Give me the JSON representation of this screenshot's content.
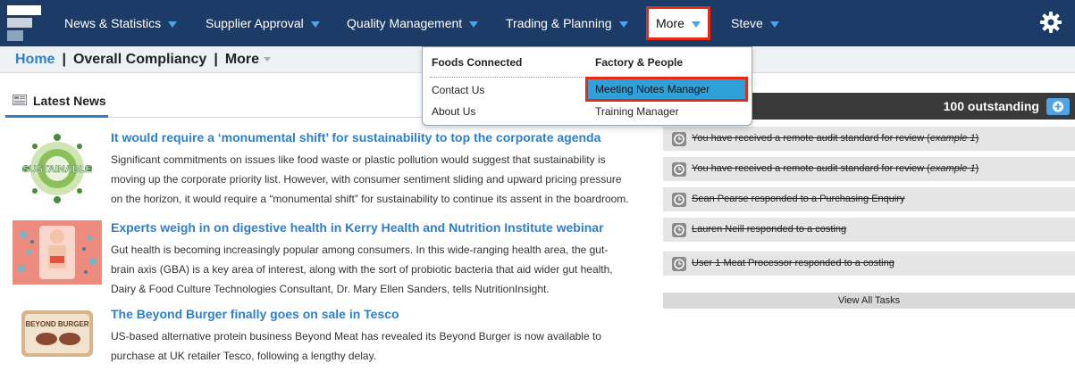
{
  "nav": {
    "items": [
      {
        "label": "News & Statistics"
      },
      {
        "label": "Supplier Approval"
      },
      {
        "label": "Quality Management"
      },
      {
        "label": "Trading & Planning"
      },
      {
        "label": "More"
      },
      {
        "label": "Steve"
      }
    ],
    "accent_color": "#4ea3e6",
    "bar_color": "#1c3b66",
    "highlight_color": "#e32b1a"
  },
  "breadcrumb": {
    "home": "Home",
    "separator": "|",
    "section": "Overall Compliancy",
    "more": "More"
  },
  "news": {
    "title": "Latest News",
    "articles": [
      {
        "title": "It would require a ‘monumental shift’ for sustainability to top the corporate agenda",
        "body": "Significant commitments on issues like food waste or plastic pollution would suggest that sustainability is moving up the corporate priority list. However, with consumer sentiment sliding and upward pricing pressure on the horizon, it would require a “monumental shift” for sustainability to continue its assent in the boardroom.",
        "thumb_text": "SUSTAINABLE"
      },
      {
        "title": "Experts weigh in on digestive health in Kerry Health and Nutrition Institute webinar",
        "body": "Gut health is becoming increasingly popular among consumers. In this wide-ranging health area, the gut-brain axis (GBA) is a key area of interest, along with the sort of probiotic bacteria that aid wider gut health, Dairy & Food Culture Technologies Consultant, Dr. Mary Ellen Sanders, tells NutritionInsight."
      },
      {
        "title": "The Beyond Burger finally goes on sale in Tesco",
        "body": "US-based alternative protein business Beyond Meat has revealed its Beyond Burger is now available to purchase at UK retailer Tesco, following a lengthy delay.",
        "thumb_text": "BEYOND BURGER"
      }
    ]
  },
  "tasks": {
    "count_label": "100 outstanding",
    "items": [
      {
        "text": "You have received a remote audit standard for review (",
        "italic": "example 1",
        "close": ")"
      },
      {
        "text": "You have received a remote audit standard for review (",
        "italic": "example 1",
        "close": ")"
      },
      {
        "text": "Sean Pearse responded to a Purchasing Enquiry"
      },
      {
        "text": "Lauren Neill responded to a costing"
      },
      {
        "text": "User 1 Meat Processor responded to a costing"
      }
    ],
    "view_all": "View All Tasks"
  },
  "dropdown": {
    "col1_head": "Foods Connected",
    "col1_items": [
      "Contact Us",
      "About Us"
    ],
    "col2_head": "Factory & People",
    "col2_items": [
      "Meeting Notes Manager",
      "Training Manager"
    ]
  },
  "icons": [
    "logo-icon",
    "gear-icon",
    "newspaper-icon",
    "plus-icon",
    "clock-icon"
  ]
}
